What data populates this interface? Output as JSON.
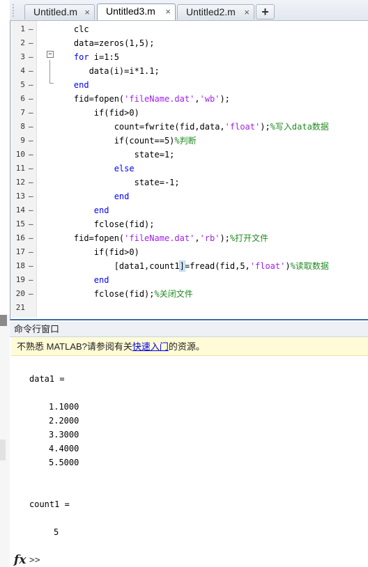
{
  "editor": {
    "tabs": [
      {
        "label": "Untitled.m",
        "close": "×"
      },
      {
        "label": "Untitled3.m",
        "close": "×"
      },
      {
        "label": "Untitled2.m",
        "close": "×"
      }
    ],
    "add_tab": "+",
    "lines": [
      {
        "n": "1",
        "dash": "–",
        "segs": [
          [
            "p",
            "    clc"
          ]
        ]
      },
      {
        "n": "2",
        "dash": "–",
        "segs": [
          [
            "p",
            "    data=zeros(1,5);"
          ]
        ]
      },
      {
        "n": "3",
        "dash": "–",
        "segs": [
          [
            "k",
            "    for"
          ],
          [
            "p",
            " i=1:5"
          ]
        ]
      },
      {
        "n": "4",
        "dash": "–",
        "segs": [
          [
            "p",
            "       data(i)=i*1.1;"
          ]
        ]
      },
      {
        "n": "5",
        "dash": "–",
        "segs": [
          [
            "k",
            "    end"
          ]
        ]
      },
      {
        "n": "6",
        "dash": "–",
        "segs": [
          [
            "p",
            "    fid=fopen("
          ],
          [
            "s",
            "'fileName.dat'"
          ],
          [
            "p",
            ","
          ],
          [
            "s",
            "'wb'"
          ],
          [
            "p",
            ");"
          ]
        ]
      },
      {
        "n": "7",
        "dash": "–",
        "segs": [
          [
            "p",
            "        if(fid>0)"
          ]
        ]
      },
      {
        "n": "8",
        "dash": "–",
        "segs": [
          [
            "p",
            "            count=fwrite(fid,data,"
          ],
          [
            "s",
            "'float'"
          ],
          [
            "p",
            ");"
          ],
          [
            "c",
            "%写入data数据"
          ]
        ]
      },
      {
        "n": "9",
        "dash": "–",
        "segs": [
          [
            "p",
            "            if(count==5)"
          ],
          [
            "c",
            "%判断"
          ]
        ]
      },
      {
        "n": "10",
        "dash": "–",
        "segs": [
          [
            "p",
            "                state=1;"
          ]
        ]
      },
      {
        "n": "11",
        "dash": "–",
        "segs": [
          [
            "k",
            "            else"
          ]
        ]
      },
      {
        "n": "12",
        "dash": "–",
        "segs": [
          [
            "p",
            "                state=-1;"
          ]
        ]
      },
      {
        "n": "13",
        "dash": "–",
        "segs": [
          [
            "k",
            "            end"
          ]
        ]
      },
      {
        "n": "14",
        "dash": "–",
        "segs": [
          [
            "k",
            "        end"
          ]
        ]
      },
      {
        "n": "15",
        "dash": "–",
        "segs": [
          [
            "p",
            "        fclose(fid);"
          ]
        ]
      },
      {
        "n": "16",
        "dash": "–",
        "segs": [
          [
            "p",
            "    fid=fopen("
          ],
          [
            "s",
            "'fileName.dat'"
          ],
          [
            "p",
            ","
          ],
          [
            "s",
            "'rb'"
          ],
          [
            "p",
            ");"
          ],
          [
            "c",
            "%打开文件"
          ]
        ]
      },
      {
        "n": "17",
        "dash": "–",
        "segs": [
          [
            "p",
            "        if(fid>0)"
          ]
        ]
      },
      {
        "n": "18",
        "dash": "–",
        "segs": [
          [
            "p",
            "            [data1,count1"
          ],
          [
            "h",
            "]"
          ],
          [
            "p",
            "=fread(fid,5,"
          ],
          [
            "s",
            "'float'"
          ],
          [
            "p",
            ")"
          ],
          [
            "c",
            "%读取数据"
          ]
        ]
      },
      {
        "n": "19",
        "dash": "–",
        "segs": [
          [
            "k",
            "        end"
          ]
        ]
      },
      {
        "n": "20",
        "dash": "–",
        "segs": [
          [
            "p",
            "        fclose(fid);"
          ],
          [
            "c",
            "%关闭文件"
          ]
        ]
      },
      {
        "n": "21",
        "dash": "",
        "segs": []
      }
    ]
  },
  "command_window": {
    "title": "命令行窗口",
    "hint_prefix": "不熟悉 MATLAB?请参阅有关",
    "hint_link": "快速入门",
    "hint_suffix": "的资源。",
    "output": {
      "data1_label": "data1 =",
      "data1_values": [
        "1.1000",
        "2.2000",
        "3.3000",
        "4.4000",
        "5.5000"
      ],
      "count1_label": "count1 =",
      "count1_value": "5"
    },
    "prompt_icon": "fx",
    "prompt": ">>"
  }
}
